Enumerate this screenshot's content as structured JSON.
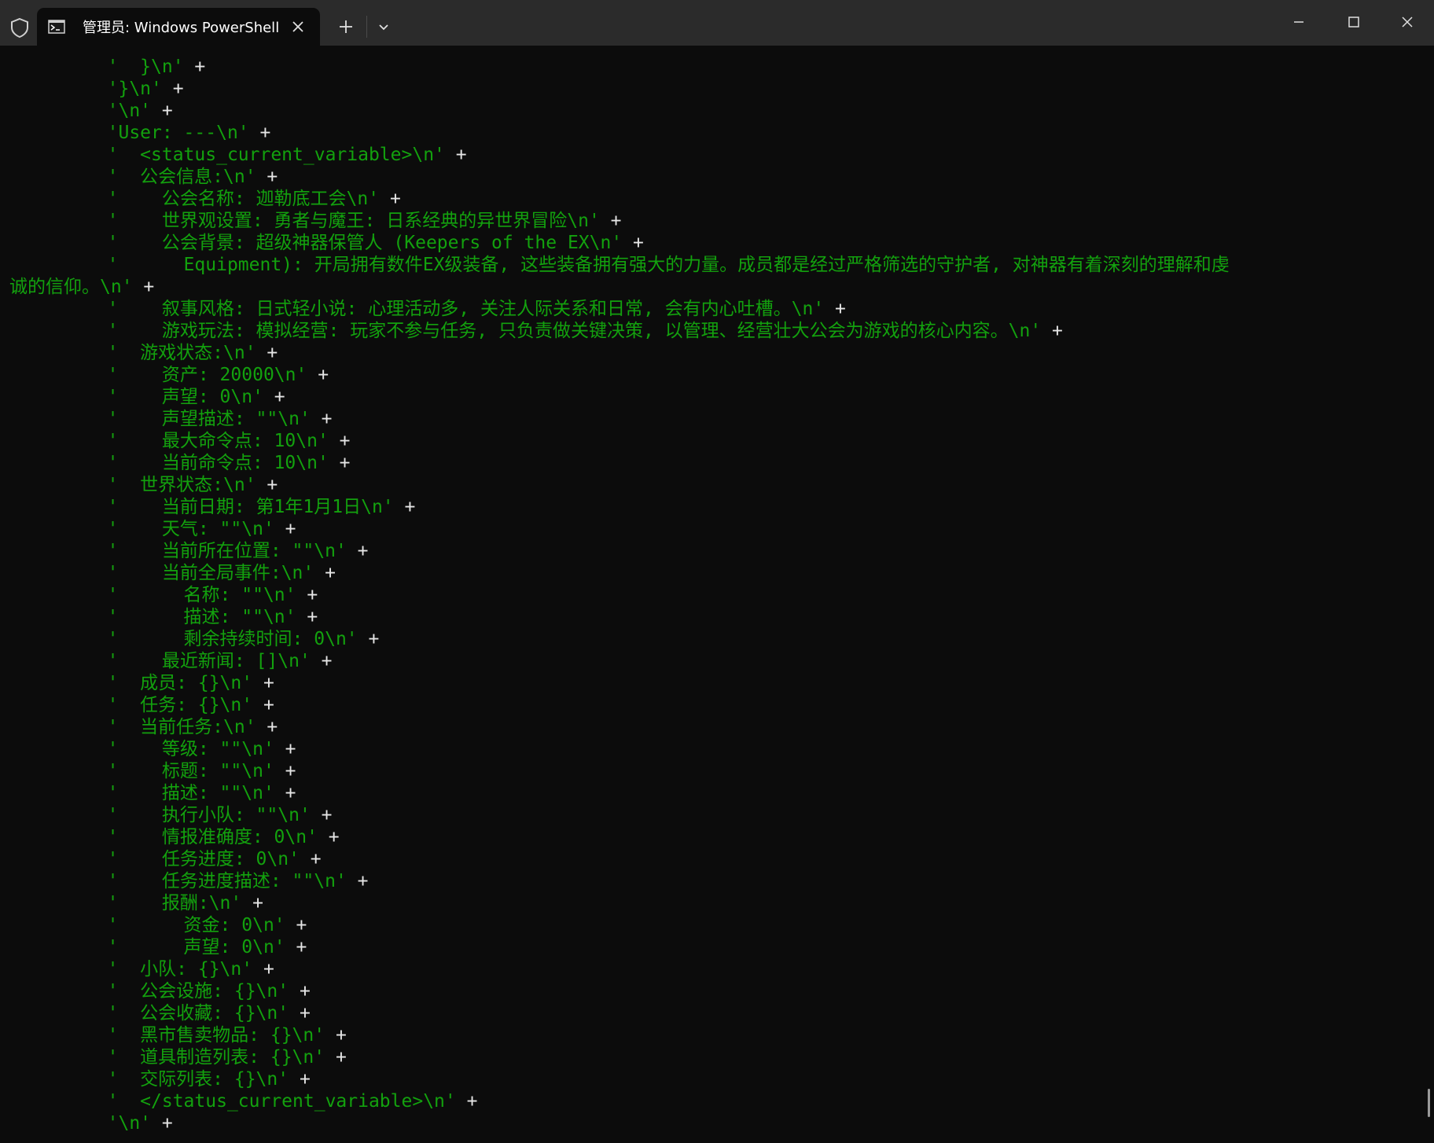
{
  "titlebar": {
    "tab_title": "管理员: Windows PowerShell"
  },
  "icons": {
    "shield": "shield-icon",
    "terminal": "terminal-icon",
    "close_tab": "close-icon",
    "new_tab": "plus-icon",
    "dropdown": "chevron-down-icon",
    "minimize": "minimize-icon",
    "maximize": "maximize-icon",
    "close_window": "close-icon"
  },
  "colors": {
    "string": "#13a10e",
    "operator": "#e6e6e6",
    "background": "#0c0c0c",
    "titlebar": "#2b2b2b"
  },
  "terminal": {
    "lines": [
      {
        "str": "         '  }\\n'",
        "op": " +"
      },
      {
        "str": "         '}\\n'",
        "op": " +"
      },
      {
        "str": "         '\\n'",
        "op": " +"
      },
      {
        "str": "         'User: ---\\n'",
        "op": " +"
      },
      {
        "str": "         '  <status_current_variable>\\n'",
        "op": " +"
      },
      {
        "str": "         '  公会信息:\\n'",
        "op": " +"
      },
      {
        "str": "         '    公会名称: 迦勒底工会\\n'",
        "op": " +"
      },
      {
        "str": "         '    世界观设置: 勇者与魔王: 日系经典的异世界冒险\\n'",
        "op": " +"
      },
      {
        "str": "         '    公会背景: 超级神器保管人 (Keepers of the EX\\n'",
        "op": " +"
      },
      {
        "str": "         '      Equipment): 开局拥有数件EX级装备, 这些装备拥有强大的力量。成员都是经过严格筛选的守护者, 对神器有着深刻的理解和虔",
        "op": ""
      },
      {
        "str": "诚的信仰。\\n'",
        "op": " +"
      },
      {
        "str": "         '    叙事风格: 日式轻小说: 心理活动多, 关注人际关系和日常, 会有内心吐槽。\\n'",
        "op": " +"
      },
      {
        "str": "         '    游戏玩法: 模拟经营: 玩家不参与任务, 只负责做关键决策, 以管理、经营壮大公会为游戏的核心内容。\\n'",
        "op": " +"
      },
      {
        "str": "         '  游戏状态:\\n'",
        "op": " +"
      },
      {
        "str": "         '    资产: 20000\\n'",
        "op": " +"
      },
      {
        "str": "         '    声望: 0\\n'",
        "op": " +"
      },
      {
        "str": "         '    声望描述: \"\"\\n'",
        "op": " +"
      },
      {
        "str": "         '    最大命令点: 10\\n'",
        "op": " +"
      },
      {
        "str": "         '    当前命令点: 10\\n'",
        "op": " +"
      },
      {
        "str": "         '  世界状态:\\n'",
        "op": " +"
      },
      {
        "str": "         '    当前日期: 第1年1月1日\\n'",
        "op": " +"
      },
      {
        "str": "         '    天气: \"\"\\n'",
        "op": " +"
      },
      {
        "str": "         '    当前所在位置: \"\"\\n'",
        "op": " +"
      },
      {
        "str": "         '    当前全局事件:\\n'",
        "op": " +"
      },
      {
        "str": "         '      名称: \"\"\\n'",
        "op": " +"
      },
      {
        "str": "         '      描述: \"\"\\n'",
        "op": " +"
      },
      {
        "str": "         '      剩余持续时间: 0\\n'",
        "op": " +"
      },
      {
        "str": "         '    最近新闻: []\\n'",
        "op": " +"
      },
      {
        "str": "         '  成员: {}\\n'",
        "op": " +"
      },
      {
        "str": "         '  任务: {}\\n'",
        "op": " +"
      },
      {
        "str": "         '  当前任务:\\n'",
        "op": " +"
      },
      {
        "str": "         '    等级: \"\"\\n'",
        "op": " +"
      },
      {
        "str": "         '    标题: \"\"\\n'",
        "op": " +"
      },
      {
        "str": "         '    描述: \"\"\\n'",
        "op": " +"
      },
      {
        "str": "         '    执行小队: \"\"\\n'",
        "op": " +"
      },
      {
        "str": "         '    情报准确度: 0\\n'",
        "op": " +"
      },
      {
        "str": "         '    任务进度: 0\\n'",
        "op": " +"
      },
      {
        "str": "         '    任务进度描述: \"\"\\n'",
        "op": " +"
      },
      {
        "str": "         '    报酬:\\n'",
        "op": " +"
      },
      {
        "str": "         '      资金: 0\\n'",
        "op": " +"
      },
      {
        "str": "         '      声望: 0\\n'",
        "op": " +"
      },
      {
        "str": "         '  小队: {}\\n'",
        "op": " +"
      },
      {
        "str": "         '  公会设施: {}\\n'",
        "op": " +"
      },
      {
        "str": "         '  公会收藏: {}\\n'",
        "op": " +"
      },
      {
        "str": "         '  黑市售卖物品: {}\\n'",
        "op": " +"
      },
      {
        "str": "         '  道具制造列表: {}\\n'",
        "op": " +"
      },
      {
        "str": "         '  交际列表: {}\\n'",
        "op": " +"
      },
      {
        "str": "         '  </status_current_variable>\\n'",
        "op": " +"
      },
      {
        "str": "         '\\n'",
        "op": " +"
      }
    ]
  }
}
